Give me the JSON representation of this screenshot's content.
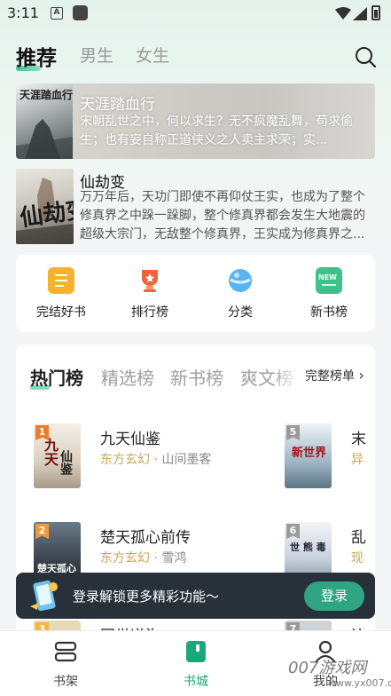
{
  "status_bar": {
    "time": "3:11",
    "a_icon": "A"
  },
  "tabs": [
    {
      "label": "推荐",
      "active": true
    },
    {
      "label": "男生",
      "active": false
    },
    {
      "label": "女生",
      "active": false
    }
  ],
  "featured": [
    {
      "title": "天涯踏血行",
      "desc": "宋朝乱世之中，何以求生？无不疯魔乱舞，苟求偷生；也有妄自称正道侠义之人卖主求荣；实...",
      "cover_text": "天涯踏血行"
    },
    {
      "title": "仙劫变",
      "desc": "万万年后，天功门即使不再仰仗王实，也成为了整个修真界之中跺一跺脚，整个修真界都会发生大地震的超级大宗门，无敌整个修真界，王实成为修真界之...",
      "cover_text": "仙劫变"
    }
  ],
  "categories": [
    {
      "label": "完结好书",
      "icon": "finished-books-icon",
      "color": "#f5a623"
    },
    {
      "label": "排行榜",
      "icon": "trophy-icon",
      "color": "#f0643c"
    },
    {
      "label": "分类",
      "icon": "category-icon",
      "color": "#4aa8f0"
    },
    {
      "label": "新书榜",
      "icon": "new-books-icon",
      "color": "#3cc28a"
    }
  ],
  "rank": {
    "tabs": [
      "热门榜",
      "精选榜",
      "新书榜",
      "爽文榜"
    ],
    "more_label": "完整榜单",
    "more_arrow": "›",
    "items": [
      {
        "rank": "1",
        "title": "九天仙鉴",
        "genre": "东方玄幻",
        "author": "山间墨客"
      },
      {
        "rank": "2",
        "title": "楚天孤心前传",
        "genre": "东方玄幻",
        "author": "雪鸿"
      },
      {
        "rank": "3",
        "title": "同世道沟",
        "genre": "",
        "author": ""
      },
      {
        "rank": "5",
        "title": "末",
        "genre": "异",
        "author": ""
      },
      {
        "rank": "6",
        "title": "乱",
        "genre": "现",
        "author": ""
      },
      {
        "rank": "7",
        "title": "边",
        "genre": "",
        "author": ""
      }
    ],
    "separator": "·"
  },
  "login_banner": {
    "text": "登录解锁更多精彩功能～",
    "button": "登录"
  },
  "bottom_nav": [
    {
      "label": "书架",
      "icon": "bookshelf-icon",
      "active": false
    },
    {
      "label": "书城",
      "icon": "bookstore-icon",
      "active": true
    },
    {
      "label": "我的",
      "icon": "profile-icon",
      "active": false
    }
  ],
  "watermark": {
    "brand": "007游戏网",
    "url": "www.yx007.com"
  }
}
